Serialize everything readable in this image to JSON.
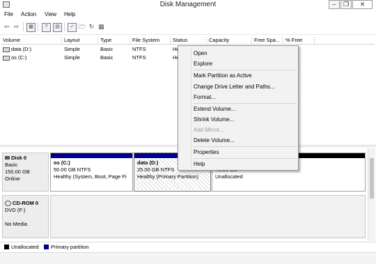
{
  "window": {
    "title": "Disk Management",
    "icon": "disk-management-icon",
    "controls": [
      "minimize",
      "restore",
      "close"
    ]
  },
  "menu": [
    "File",
    "Action",
    "View",
    "Help"
  ],
  "toolbar": [
    "back-arrow-icon",
    "forward-arrow-icon",
    "properties-icon",
    "help-icon",
    "help-book-icon",
    "volume-icon",
    "open-folder-icon",
    "refresh-icon",
    "grid-icon"
  ],
  "columns": [
    "Volume",
    "Layout",
    "Type",
    "File System",
    "Status",
    "Capacity",
    "Free Spa...",
    "% Free"
  ],
  "volumes": [
    {
      "name": "data (D:)",
      "layout": "Simple",
      "type": "Basic",
      "fs": "NTFS",
      "status": "He"
    },
    {
      "name": "os (C:)",
      "layout": "Simple",
      "type": "Basic",
      "fs": "NTFS",
      "status": "He"
    }
  ],
  "disks": [
    {
      "label_name": "Disk 0",
      "label_type": "Basic",
      "label_size": "150.00 GB",
      "label_state": "Online",
      "partitions": [
        {
          "title": "os  (C:)",
          "size": "50.00 GB NTFS",
          "status": "Healthy (System, Boot, Page Fi"
        },
        {
          "title": "data  (D:)",
          "size": "25.00 GB NTFS",
          "status": "Healthy (Primary Partition)"
        },
        {
          "title": "",
          "size": "75.00 GB",
          "status": "Unallocated"
        }
      ]
    },
    {
      "label_name": "CD-ROM 0",
      "label_type": "DVD (F:)",
      "label_state": "No Media"
    }
  ],
  "legend": {
    "unallocated": "Unallocated",
    "primary": "Primary partition",
    "unallocated_color": "#000000",
    "primary_color": "#00008b"
  },
  "context_menu": {
    "open": "Open",
    "explore": "Explore",
    "mark_active": "Mark Partition as Active",
    "change_letter": "Change Drive Letter and Paths...",
    "format": "Format...",
    "extend": "Extend Volume...",
    "shrink": "Shrink Volume...",
    "add_mirror": "Add Mirror...",
    "delete": "Delete Volume...",
    "properties": "Properties",
    "help": "Help"
  }
}
